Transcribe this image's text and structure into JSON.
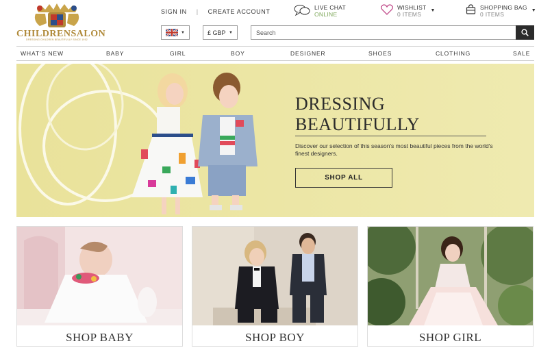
{
  "brand": {
    "name": "CHILDRENSALON",
    "tagline": "DRESSING CHILDREN BEAUTIFULLY SINCE 1952",
    "gold": "#b08a3a"
  },
  "header": {
    "sign_in": "SIGN IN",
    "create_account": "CREATE ACCOUNT",
    "live_chat": {
      "label": "LIVE CHAT",
      "status": "ONLINE",
      "icon": "chat-bubbles-icon"
    },
    "wishlist": {
      "label": "WISHLIST",
      "count": "0 ITEMS",
      "icon": "heart-icon"
    },
    "bag": {
      "label": "SHOPPING BAG",
      "count": "0 ITEMS",
      "icon": "shopping-bag-icon"
    },
    "country": {
      "icon": "uk-flag-icon"
    },
    "currency": {
      "value": "£ GBP"
    },
    "search": {
      "placeholder": "Search",
      "icon": "search-icon"
    }
  },
  "nav": {
    "items": [
      "WHAT'S NEW",
      "BABY",
      "GIRL",
      "BOY",
      "DESIGNER",
      "SHOES",
      "CLOTHING",
      "SALE"
    ]
  },
  "hero": {
    "title_line1": "DRESSING",
    "title_line2": "BEAUTIFULLY",
    "description": "Discover our selection of this season's most beautiful pieces from the world's finest designers.",
    "cta": "SHOP ALL",
    "background": "#ede8a8"
  },
  "tiles": [
    {
      "caption": "SHOP BABY"
    },
    {
      "caption": "SHOP BOY"
    },
    {
      "caption": "SHOP GIRL"
    }
  ],
  "colors": {
    "online": "#7ea85a",
    "wishlist_heart": "#c04a8a",
    "search_button": "#2b2b2b"
  }
}
